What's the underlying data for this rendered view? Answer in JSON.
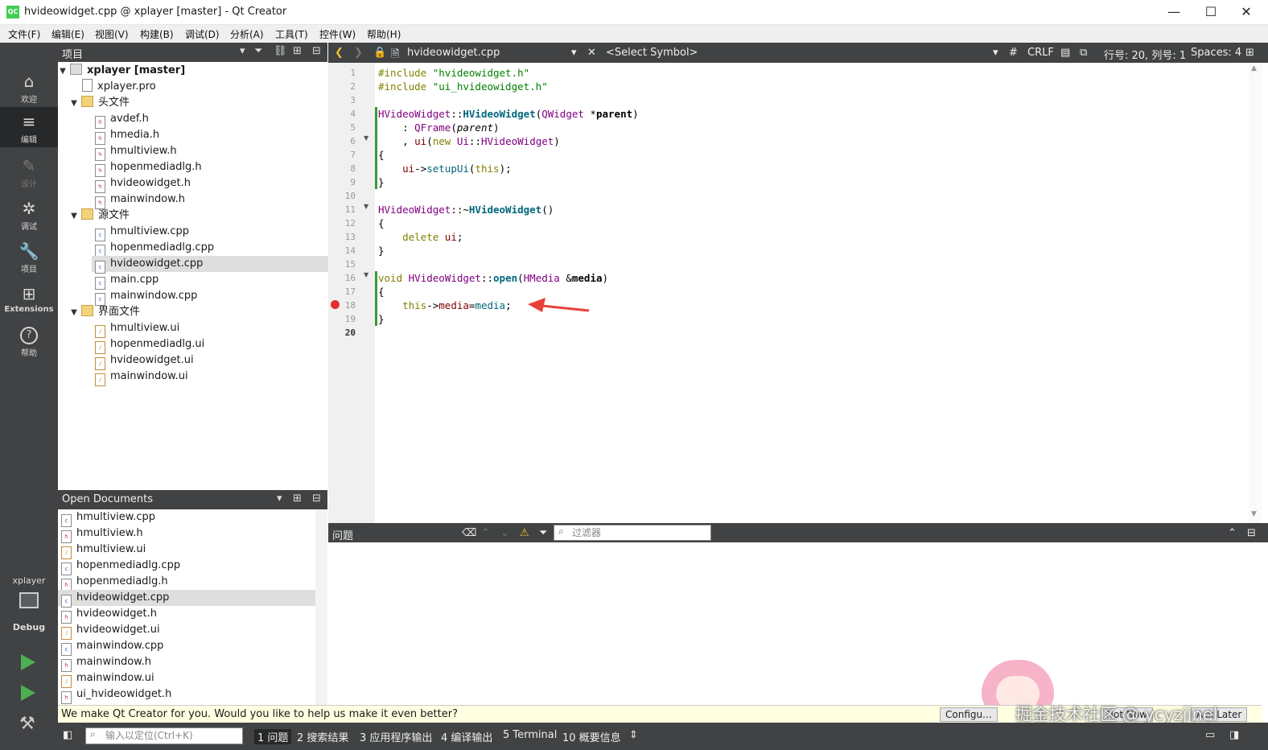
{
  "window": {
    "title": "hvideowidget.cpp @ xplayer [master] - Qt Creator",
    "app_icon": "QC",
    "minimize": "—",
    "maximize": "☐",
    "close": "✕"
  },
  "menu": [
    "文件(F)",
    "编辑(E)",
    "视图(V)",
    "构建(B)",
    "调试(D)",
    "分析(A)",
    "工具(T)",
    "控件(W)",
    "帮助(H)"
  ],
  "modes": [
    {
      "icon": "⌂",
      "label": "欢迎"
    },
    {
      "icon": "≡",
      "label": "编辑"
    },
    {
      "icon": "✎",
      "label": "设计"
    },
    {
      "icon": "✲",
      "label": "调试"
    },
    {
      "icon": "🔧",
      "label": "项目"
    },
    {
      "icon": "⊞",
      "label": "Extensions"
    },
    {
      "icon": "?",
      "label": "帮助"
    }
  ],
  "kit": {
    "project": "xplayer",
    "config": "Debug"
  },
  "project_pane": {
    "title": "项目",
    "tree": [
      {
        "label": "xplayer [master]",
        "kind": "project"
      },
      {
        "label": "xplayer.pro",
        "kind": "pro"
      },
      {
        "label": "头文件",
        "kind": "folder"
      },
      {
        "label": "avdef.h",
        "kind": "h"
      },
      {
        "label": "hmedia.h",
        "kind": "h"
      },
      {
        "label": "hmultiview.h",
        "kind": "h"
      },
      {
        "label": "hopenmediadlg.h",
        "kind": "h"
      },
      {
        "label": "hvideowidget.h",
        "kind": "h"
      },
      {
        "label": "mainwindow.h",
        "kind": "h"
      },
      {
        "label": "源文件",
        "kind": "folder"
      },
      {
        "label": "hmultiview.cpp",
        "kind": "cpp"
      },
      {
        "label": "hopenmediadlg.cpp",
        "kind": "cpp"
      },
      {
        "label": "hvideowidget.cpp",
        "kind": "cpp"
      },
      {
        "label": "main.cpp",
        "kind": "cpp"
      },
      {
        "label": "mainwindow.cpp",
        "kind": "cpp"
      },
      {
        "label": "界面文件",
        "kind": "folder"
      },
      {
        "label": "hmultiview.ui",
        "kind": "ui"
      },
      {
        "label": "hopenmediadlg.ui",
        "kind": "ui"
      },
      {
        "label": "hvideowidget.ui",
        "kind": "ui"
      },
      {
        "label": "mainwindow.ui",
        "kind": "ui"
      }
    ]
  },
  "open_documents": {
    "title": "Open Documents",
    "items": [
      "hmultiview.cpp",
      "hmultiview.h",
      "hmultiview.ui",
      "hopenmediadlg.cpp",
      "hopenmediadlg.h",
      "hvideowidget.cpp",
      "hvideowidget.h",
      "hvideowidget.ui",
      "mainwindow.cpp",
      "mainwindow.h",
      "mainwindow.ui",
      "ui_hvideowidget.h"
    ],
    "selected": "hvideowidget.cpp"
  },
  "editor": {
    "file": "hvideowidget.cpp",
    "symbol": "<Select Symbol>",
    "hash": "#",
    "line_ending": "CRLF",
    "position": "行号: 20, 列号: 1",
    "indent": "Spaces: 4",
    "line_numbers": [
      "1",
      "2",
      "3",
      "4",
      "5",
      "6",
      "7",
      "8",
      "9",
      "10",
      "11",
      "12",
      "13",
      "14",
      "15",
      "16",
      "17",
      "18",
      "19",
      "20"
    ],
    "current_line": "20"
  },
  "issues": {
    "title": "问题",
    "filter_placeholder": "过滤器"
  },
  "notification": {
    "text": "We make Qt Creator for you. Would you like to help us make it even better?",
    "btn_configure": "Configu...",
    "btn_not_now": "Not Now",
    "btn_ask_later": "Ask Later"
  },
  "status": {
    "locator_placeholder": "输入以定位(Ctrl+K)",
    "tabs": [
      "1  问题",
      "2  搜索结果",
      "3  应用程序输出",
      "4  编译输出",
      "5  Terminal",
      "10  概要信息"
    ]
  },
  "watermark": "掘金技术社区 @ ycyzjinel"
}
